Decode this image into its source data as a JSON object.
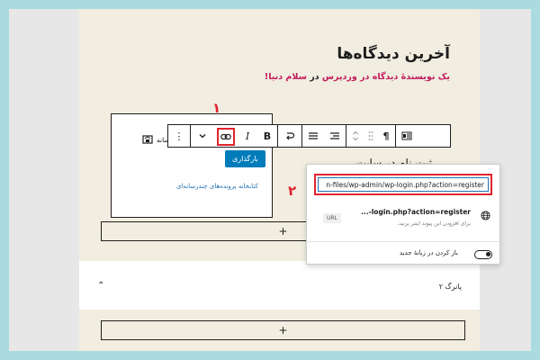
{
  "post": {
    "heading": "آخرین دیدگاه‌ها",
    "subline_pink_1": "یک نویسندهٔ دیدگاه در",
    "subline_pink_2": "وردپرس",
    "subline_mid": " در ",
    "subline_pink_3": "سلام دنیا!",
    "paragraph": "ثبت نام در سایت"
  },
  "toolbar": {
    "paragraph_icon": "¶",
    "bold_label": "B",
    "italic_label": "I",
    "more_icon": "⋮",
    "chevron_icon": "⌄"
  },
  "annotations": {
    "num1": "۱",
    "num2": "۲"
  },
  "media": {
    "label": "ناحیهٔ رسانه",
    "upload_label": "بارگذاری",
    "library_link": "کتابخانه پرونده‌های چندرسانه‌ای"
  },
  "link_popover": {
    "url_value": "n-files/wp-admin/wp-login.php?action=register",
    "suggestion_title": "...-login.php?action=register",
    "suggestion_desc": "برای افزودن این پیوند اینتر بزنید.",
    "suggestion_badge": "URL",
    "new_tab_label": "باز کردن در زبانهٔ جدید",
    "new_tab_enabled": true
  },
  "appender": {
    "plus": "+"
  },
  "section": {
    "label": "پانرگ ۲",
    "chevron": "⌃"
  },
  "colors": {
    "accent": "#007cba",
    "annotation_red": "#e0232e",
    "pink_text": "#c2185b",
    "block_bg": "#f1ede0",
    "page_bg": "#a9dbe0"
  }
}
